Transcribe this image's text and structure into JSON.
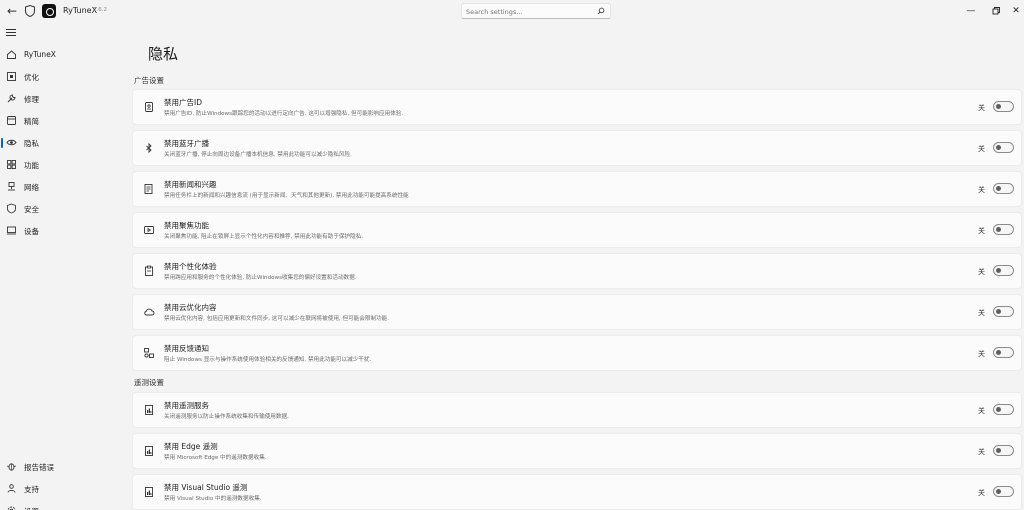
{
  "app": {
    "name": "RyTuneX",
    "version": "1.6.2"
  },
  "search": {
    "placeholder": "Search settings..."
  },
  "sidebar": {
    "items": [
      {
        "label": "RyTuneX",
        "icon": "home-icon"
      },
      {
        "label": "优化",
        "icon": "optimize-icon"
      },
      {
        "label": "修理",
        "icon": "wrench-icon"
      },
      {
        "label": "精简",
        "icon": "debloat-icon"
      },
      {
        "label": "隐私",
        "icon": "eye-icon"
      },
      {
        "label": "功能",
        "icon": "features-icon"
      },
      {
        "label": "网络",
        "icon": "network-icon"
      },
      {
        "label": "安全",
        "icon": "shield-icon"
      },
      {
        "label": "设备",
        "icon": "device-icon"
      }
    ],
    "bottom_items": [
      {
        "label": "报告错误",
        "icon": "bug-icon"
      },
      {
        "label": "支持",
        "icon": "support-icon"
      },
      {
        "label": "设置",
        "icon": "settings-icon"
      }
    ]
  },
  "page": {
    "title": "隐私"
  },
  "sections": [
    {
      "title": "广告设置",
      "items": [
        {
          "title": "禁用广告ID",
          "desc": "禁用广告ID, 防止Windows跟踪您的活动以进行定向广告, 这可以增强隐私, 但可能影响应用体验.",
          "state": "关",
          "icon": "id-badge-icon"
        },
        {
          "title": "禁用蓝牙广播",
          "desc": "关闭蓝牙广播, 停止向周边设备广播本机信息, 禁用此功能可以减少隐私风险.",
          "state": "关",
          "icon": "bluetooth-icon"
        },
        {
          "title": "禁用新闻和兴趣",
          "desc": "禁用任务栏上的新闻和兴趣信息流 (用于显示新闻、天气和其他更新), 禁用此功能可能提高系统性能",
          "state": "关",
          "icon": "news-icon"
        },
        {
          "title": "禁用聚焦功能",
          "desc": "关闭聚焦功能, 阻止在锁屏上显示个性化内容和推荐, 禁用此功能有助于保护隐私.",
          "state": "关",
          "icon": "spotlight-icon"
        },
        {
          "title": "禁用个性化体验",
          "desc": "禁用跨应用和服务的个性化体验, 防止Windows收集您的偏好设置和活动数据.",
          "state": "关",
          "icon": "clipboard-icon"
        },
        {
          "title": "禁用云优化内容",
          "desc": "禁用云优化内容, 包括应用更新和文件同步, 这可以减少在联网将被使用, 但可能会限制功能.",
          "state": "关",
          "icon": "cloud-icon"
        },
        {
          "title": "禁用反馈通知",
          "desc": "阻止 Windows 显示与操作系统使用体验相关的反馈通知, 禁用此功能可以减少干扰.",
          "state": "关",
          "icon": "feedback-icon"
        }
      ]
    },
    {
      "title": "遥测设置",
      "items": [
        {
          "title": "禁用遥测服务",
          "desc": "关闭遥测服务以防止操作系统收集和传输使用数据.",
          "state": "关",
          "icon": "telemetry-icon"
        },
        {
          "title": "禁用 Edge 遥测",
          "desc": "禁用 Microsoft Edge 中的遥测数据收集.",
          "state": "关",
          "icon": "telemetry-icon"
        },
        {
          "title": "禁用 Visual Studio 遥测",
          "desc": "禁用 Visual Studio 中的遥测数据收集.",
          "state": "关",
          "icon": "telemetry-icon"
        }
      ]
    }
  ]
}
